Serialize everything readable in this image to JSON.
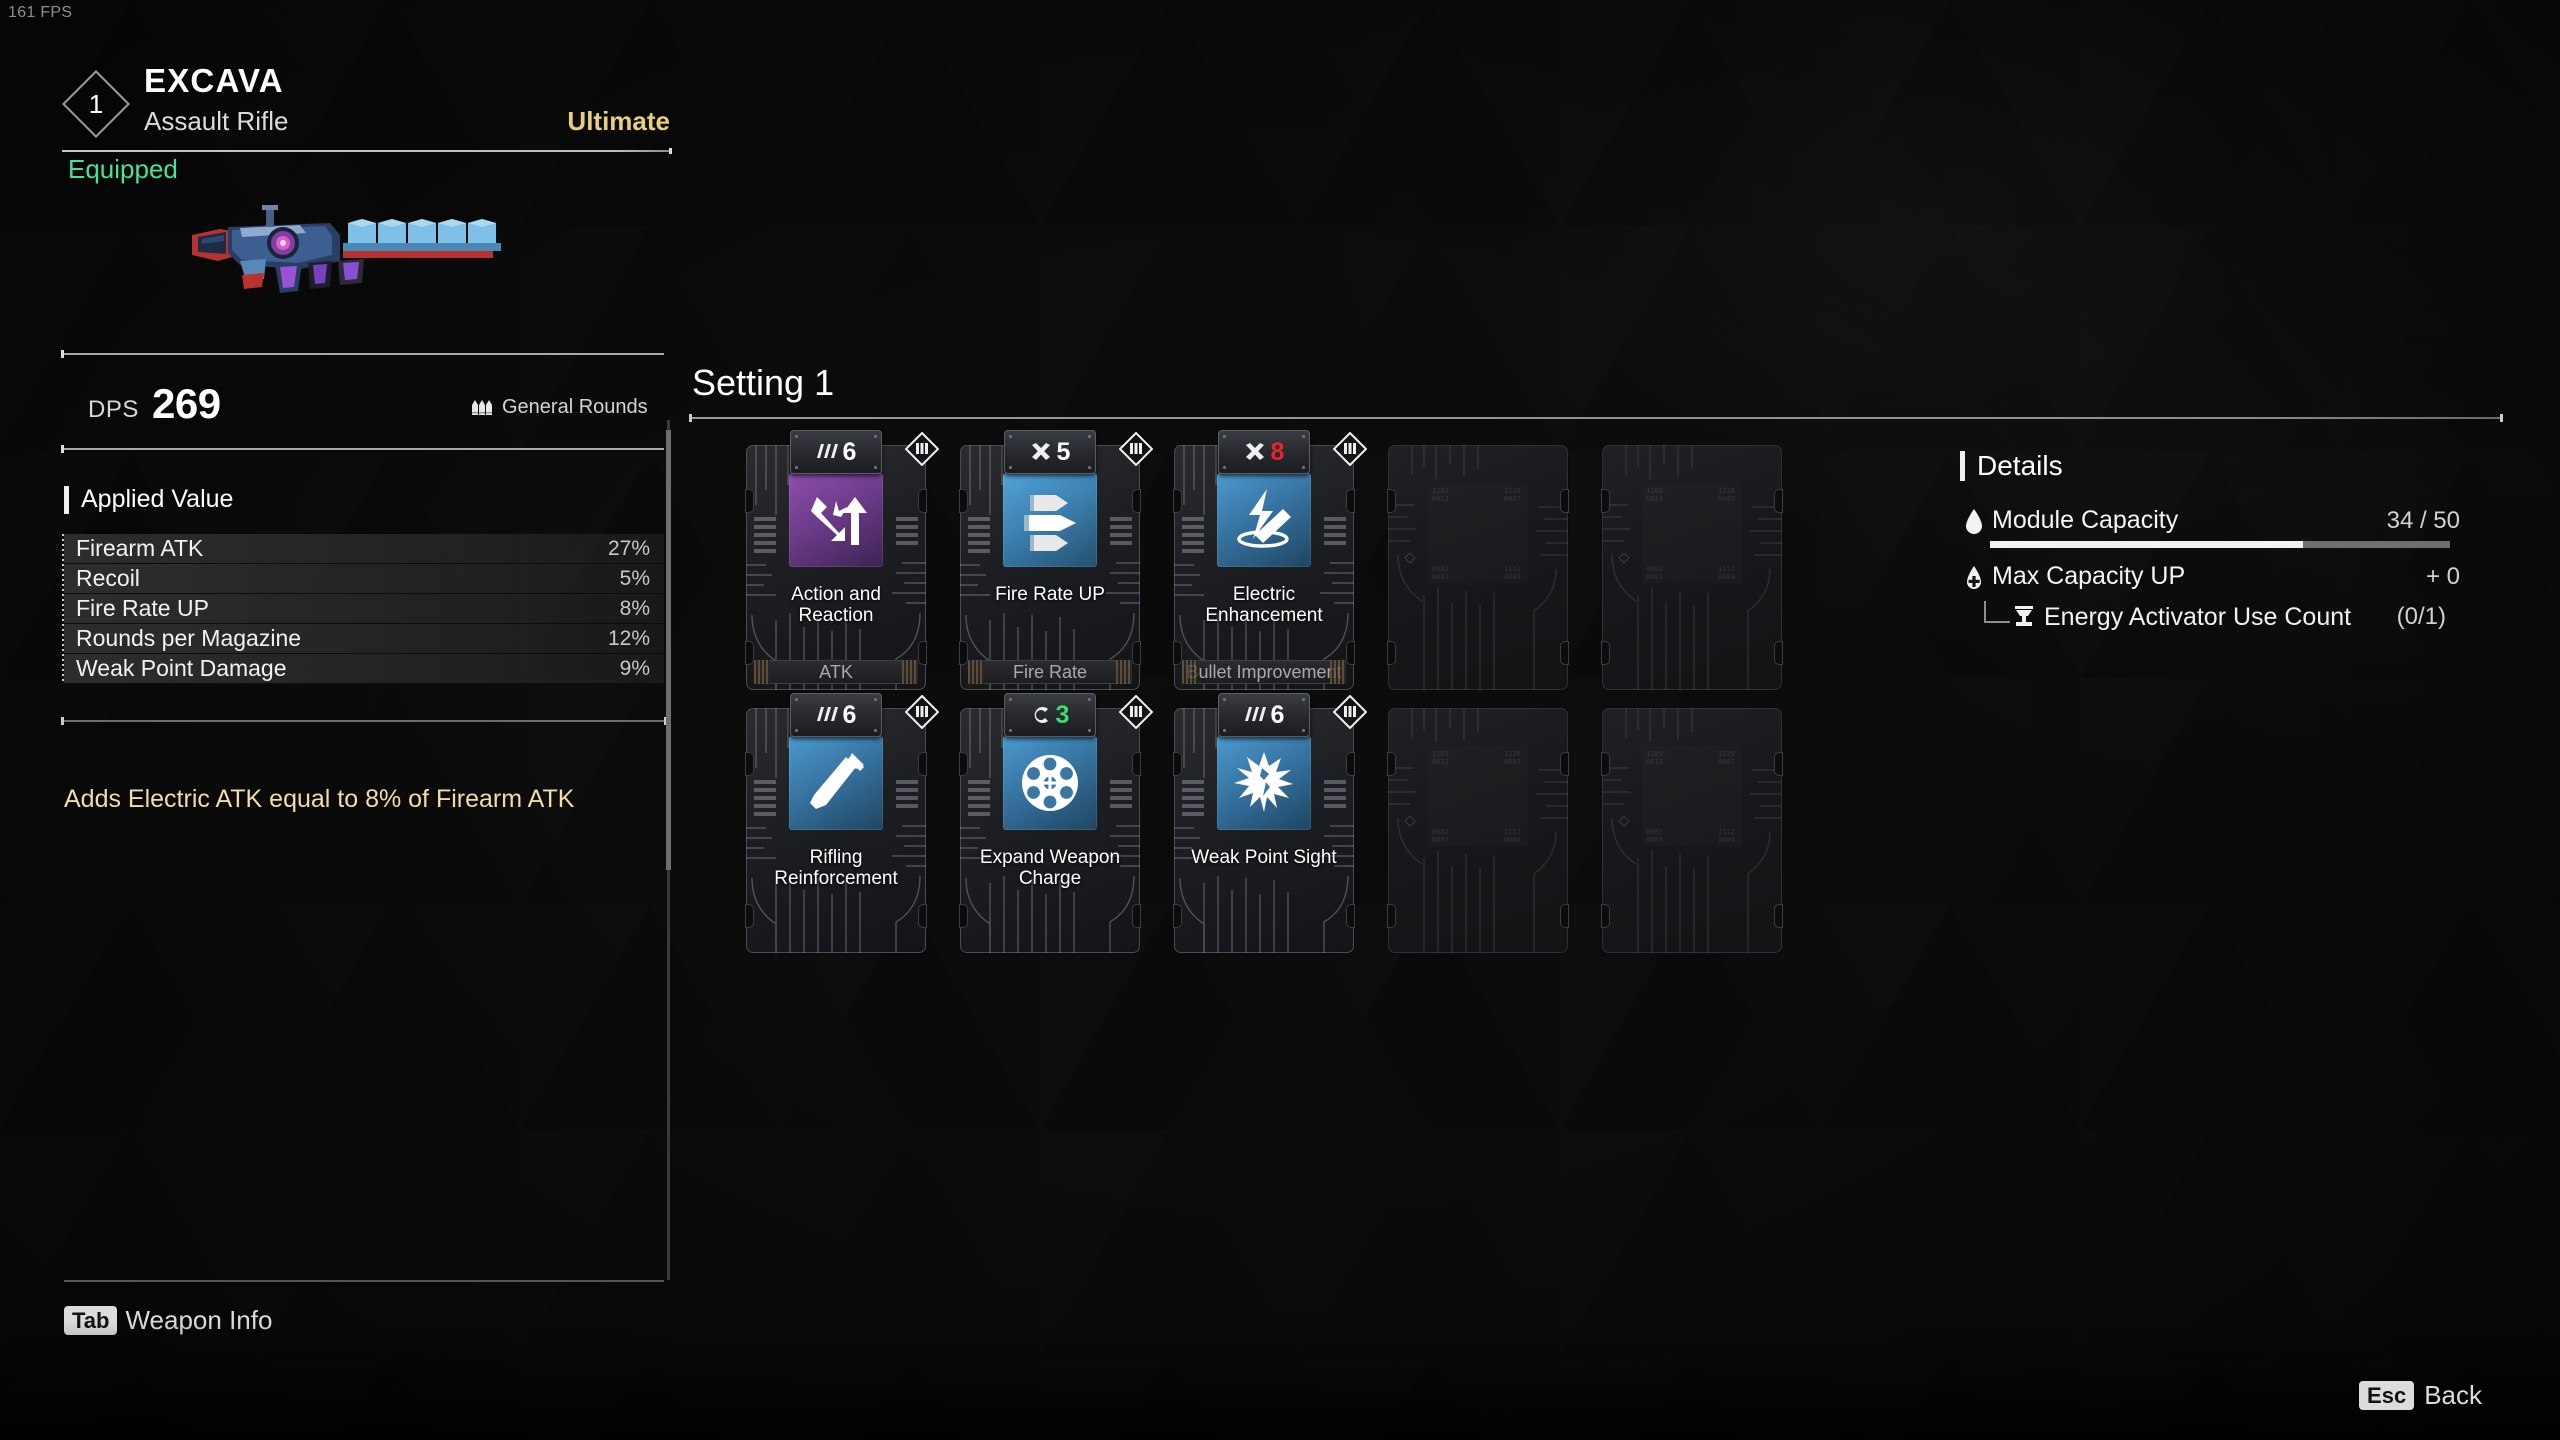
{
  "hud": {
    "fps": "161 FPS"
  },
  "weapon": {
    "slot_number": "1",
    "name": "EXCAVA",
    "type": "Assault Rifle",
    "tier": "Ultimate",
    "status": "Equipped",
    "dps_label": "DPS",
    "dps_value": "269",
    "ammo_type": "General Rounds",
    "ammo_icon": "bullets-icon"
  },
  "applied_value": {
    "heading": "Applied Value",
    "rows": [
      {
        "name": "Firearm ATK",
        "value": "27%"
      },
      {
        "name": "Recoil",
        "value": "5%"
      },
      {
        "name": "Fire Rate UP",
        "value": "8%"
      },
      {
        "name": "Rounds per Magazine",
        "value": "12%"
      },
      {
        "name": "Weak Point Damage",
        "value": "9%"
      }
    ],
    "effect_text": "Adds Electric ATK equal to 8% of Firearm ATK"
  },
  "setting": {
    "title": "Setting 1",
    "modules": [
      {
        "name": "Action and\nReaction",
        "category": "ATK",
        "level": "6",
        "level_color": "white",
        "level_icon": "bars-icon",
        "icon_bg": "purple",
        "icon": "down-up-arrows-icon",
        "socket_icon": "socket-diamond-icon",
        "empty": false
      },
      {
        "name": "Fire Rate UP",
        "category": "Fire Rate",
        "level": "5",
        "level_color": "white",
        "level_icon": "cross-icon",
        "icon_bg": "blue",
        "icon": "three-bullets-icon",
        "socket_icon": "socket-diamond-icon",
        "empty": false
      },
      {
        "name": "Electric\nEnhancement",
        "category": "Bullet Improvement",
        "level": "8",
        "level_color": "red",
        "level_icon": "cross-icon",
        "icon_bg": "blue2",
        "icon": "electric-bolt-icon",
        "socket_icon": "socket-diamond-icon",
        "empty": false
      },
      {
        "name": "",
        "category": "",
        "level": "",
        "level_color": "white",
        "empty": true
      },
      {
        "name": "",
        "category": "",
        "level": "",
        "level_color": "white",
        "empty": true
      },
      {
        "name": "Rifling\nReinforcement",
        "category": "",
        "level": "6",
        "level_color": "white",
        "level_icon": "bars-icon",
        "icon_bg": "blue2",
        "icon": "bullet-up-icon",
        "socket_icon": "socket-diamond-icon",
        "empty": false
      },
      {
        "name": "Expand Weapon\nCharge",
        "category": "",
        "level": "3",
        "level_color": "green",
        "level_icon": "c-icon",
        "icon_bg": "blue2",
        "icon": "revolver-cylinder-icon",
        "socket_icon": "socket-diamond-icon",
        "empty": false
      },
      {
        "name": "Weak Point Sight",
        "category": "",
        "level": "6",
        "level_color": "white",
        "level_icon": "bars-icon",
        "icon_bg": "blue2",
        "icon": "weakpoint-burst-icon",
        "socket_icon": "socket-diamond-icon",
        "empty": false
      },
      {
        "name": "",
        "category": "",
        "level": "",
        "level_color": "white",
        "empty": true
      },
      {
        "name": "",
        "category": "",
        "level": "",
        "level_color": "white",
        "empty": true
      }
    ]
  },
  "details": {
    "heading": "Details",
    "module_capacity_label": "Module Capacity",
    "module_capacity_value": "34 / 50",
    "module_capacity_current": 34,
    "module_capacity_max": 50,
    "max_capacity_label": "Max Capacity UP",
    "max_capacity_value": "+ 0",
    "energy_activator_label": "Energy Activator Use Count",
    "energy_activator_value": "(0/1)"
  },
  "footer": {
    "tab_key": "Tab",
    "tab_label": "Weapon Info",
    "esc_key": "Esc",
    "esc_label": "Back"
  }
}
